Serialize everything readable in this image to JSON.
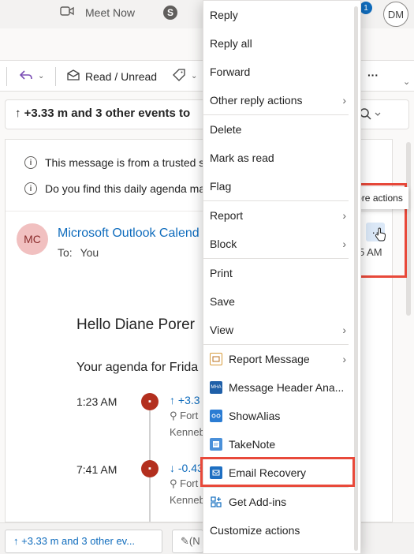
{
  "topbar": {
    "meet_now": "Meet Now",
    "notification_count": "1",
    "user_initials": "DM"
  },
  "toolbar": {
    "read_unread": "Read / Unread",
    "more": "···"
  },
  "subject": {
    "text": "↑ +3.33 m and 3 other events to"
  },
  "message": {
    "notice1": "This message is from a trusted se",
    "notice2": "Do you find this daily agenda ma",
    "sender_initials": "MC",
    "sender": "Microsoft Outlook Calend",
    "to_label": "To:",
    "to_value": "You",
    "greeting": "Hello Diane Porer",
    "agenda": "Your agenda for Frida",
    "events": [
      {
        "time": "1:23 AM",
        "title": "↑ +3.3",
        "loc": "Fort",
        "loc2": "Kenneb"
      },
      {
        "time": "7:41 AM",
        "title": "↓ -0.43",
        "loc": "Fort",
        "loc2": "Kenneb"
      }
    ],
    "time_partial": "5 AM"
  },
  "tooltip": {
    "more_actions": "More actions"
  },
  "bottom": {
    "tab1": "↑ +3.33 m and 3 other ev...",
    "tab2": "(N"
  },
  "menu": {
    "items": [
      {
        "label": "Reply"
      },
      {
        "label": "Reply all"
      },
      {
        "label": "Forward"
      },
      {
        "label": "Other reply actions"
      },
      {
        "label": "Delete"
      },
      {
        "label": "Mark as read"
      },
      {
        "label": "Flag"
      },
      {
        "label": "Report"
      },
      {
        "label": "Block"
      },
      {
        "label": "Print"
      },
      {
        "label": "Save"
      },
      {
        "label": "View"
      },
      {
        "label": "Report Message"
      },
      {
        "label": "Message Header Ana..."
      },
      {
        "label": "ShowAlias"
      },
      {
        "label": "TakeNote"
      },
      {
        "label": "Email Recovery"
      },
      {
        "label": "Get Add-ins"
      },
      {
        "label": "Customize actions"
      }
    ]
  },
  "colors": {
    "accent": "#0f6cbd",
    "highlight": "#e8493a",
    "event_dot": "#b32f1e"
  }
}
